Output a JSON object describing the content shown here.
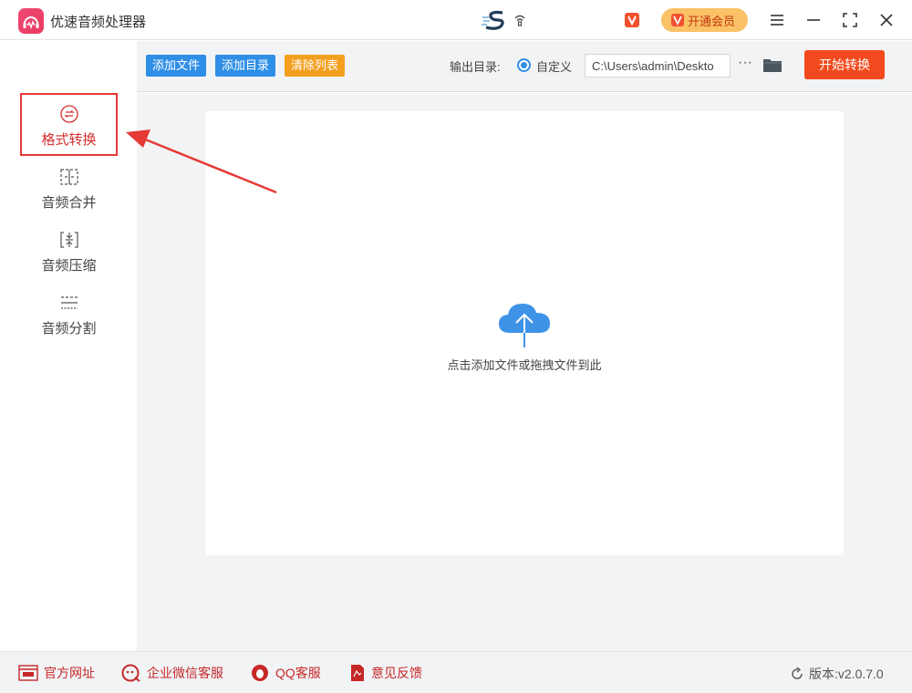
{
  "app": {
    "title": "优速音频处理器"
  },
  "titlebar": {
    "vip_label": "开通会员"
  },
  "sidebar": {
    "items": [
      {
        "label": "格式转换",
        "icon": "format-convert-icon",
        "active": true
      },
      {
        "label": "音频合并",
        "icon": "merge-icon",
        "active": false
      },
      {
        "label": "音频压缩",
        "icon": "compress-icon",
        "active": false
      },
      {
        "label": "音频分割",
        "icon": "split-icon",
        "active": false
      }
    ]
  },
  "toolbar": {
    "add_file": "添加文件",
    "add_dir": "添加目录",
    "clear_list": "清除列表",
    "output_label": "输出目录:",
    "custom_label": "自定义",
    "output_path": "C:\\Users\\admin\\Deskto",
    "more": "···",
    "start": "开始转换"
  },
  "main": {
    "drop_hint": "点击添加文件或拖拽文件到此"
  },
  "footer": {
    "website": "官方网址",
    "wechat": "企业微信客服",
    "qq": "QQ客服",
    "feedback": "意见反馈",
    "version": "版本:v2.0.7.0"
  },
  "colors": {
    "accent_blue": "#2f8fe6",
    "accent_orange": "#f3a020",
    "start_red": "#f24a1e",
    "footer_red": "#c62828",
    "vip_gold": "#fbc167"
  }
}
